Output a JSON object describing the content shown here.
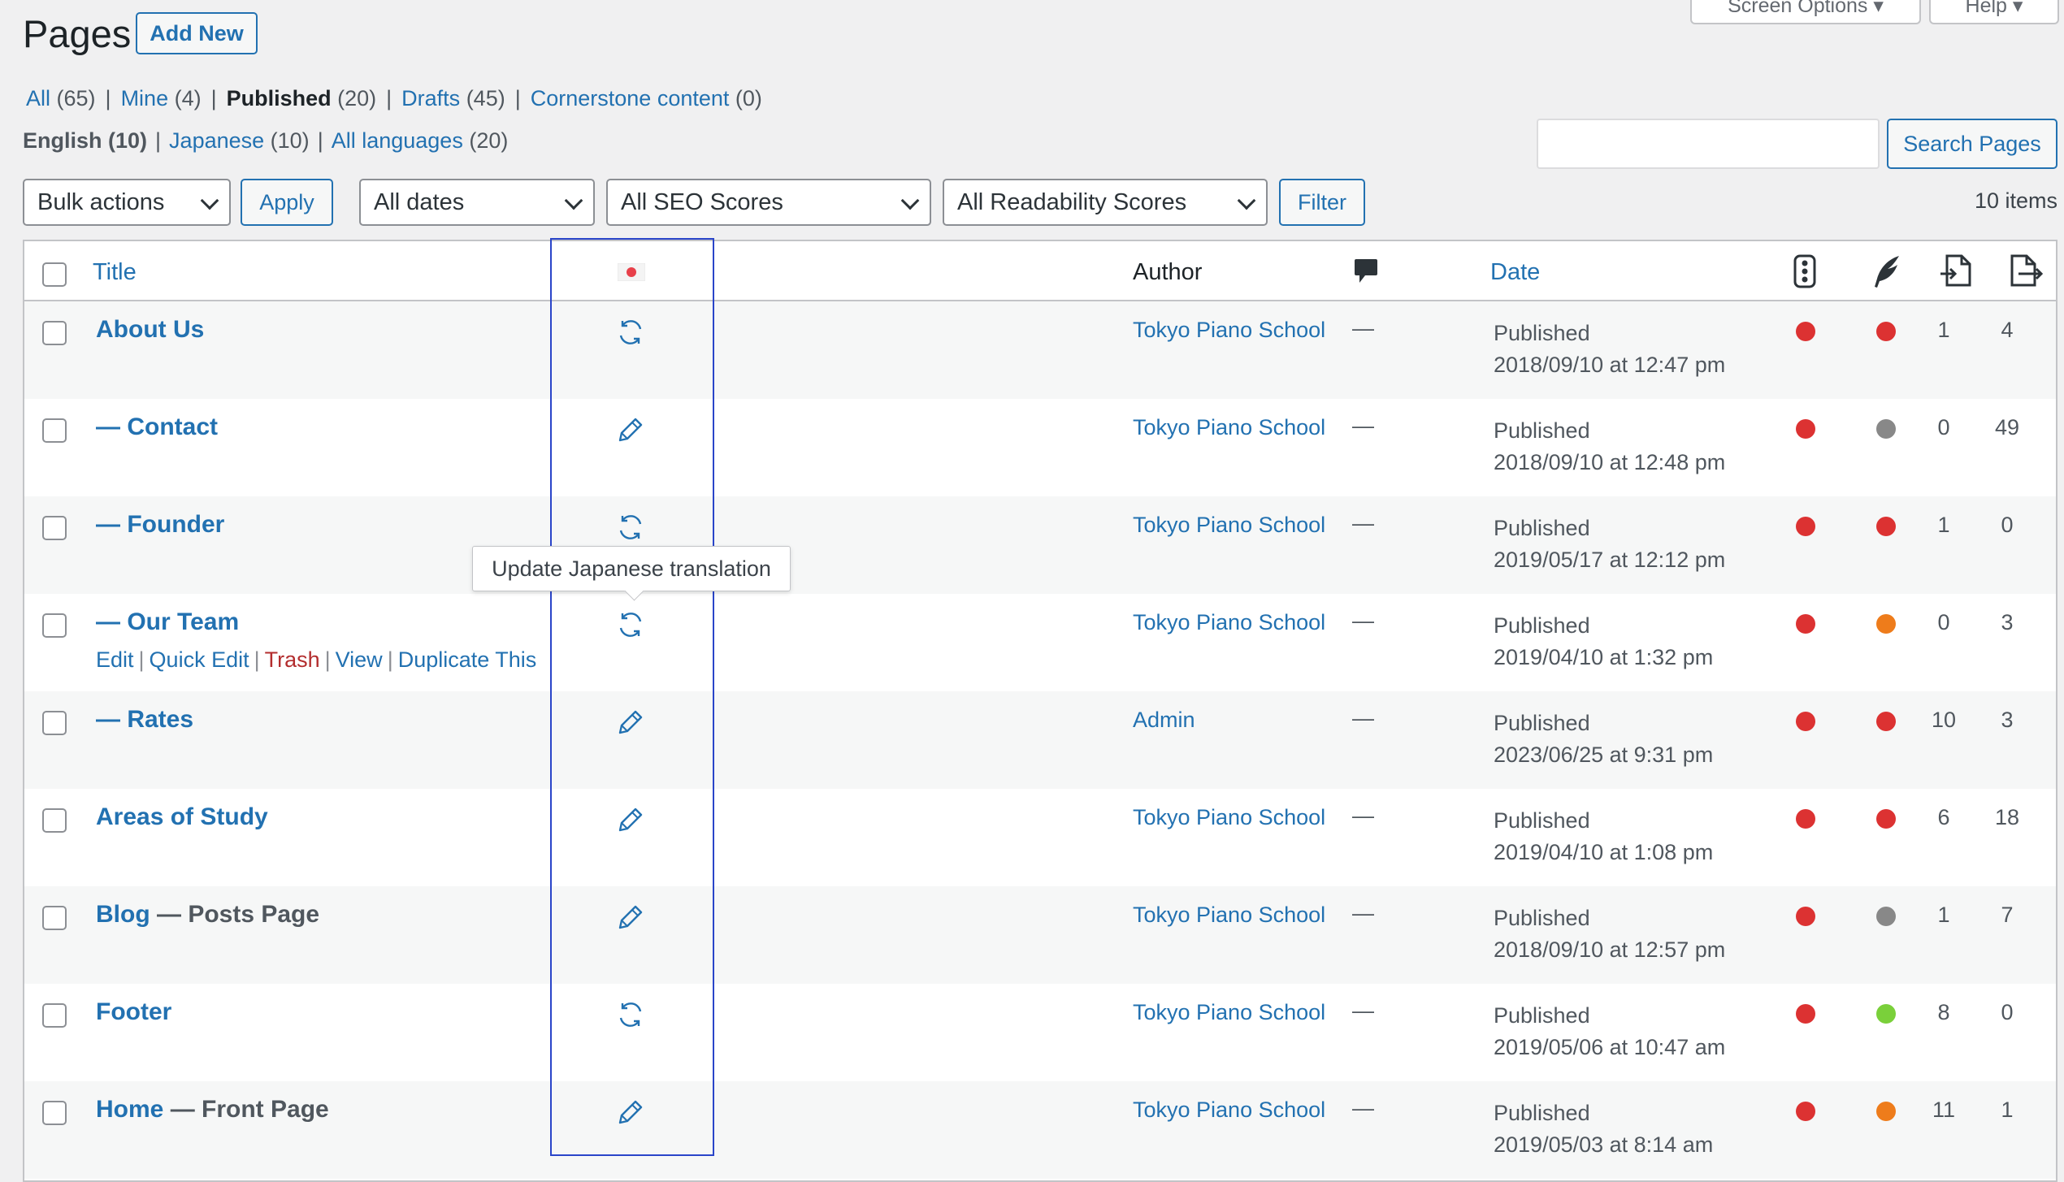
{
  "header": {
    "title": "Pages",
    "add_new_label": "Add New",
    "screen_options_label": "Screen Options ▾",
    "help_label": "Help ▾"
  },
  "views": [
    {
      "label": "All",
      "count": "(65)",
      "current": false
    },
    {
      "label": "Mine",
      "count": "(4)",
      "current": false
    },
    {
      "label": "Published",
      "count": "(20)",
      "current": true
    },
    {
      "label": "Drafts",
      "count": "(45)",
      "current": false
    },
    {
      "label": "Cornerstone content",
      "count": " (0)",
      "current": false
    }
  ],
  "languages": [
    {
      "label": "English",
      "count": "(10)",
      "current": true
    },
    {
      "label": "Japanese",
      "count": "(10)",
      "current": false
    },
    {
      "label": "All languages",
      "count": "(20)",
      "current": false
    }
  ],
  "search": {
    "placeholder": "",
    "button_label": "Search Pages"
  },
  "toolbar": {
    "bulk_actions": "Bulk actions",
    "apply_label": "Apply",
    "dates": "All dates",
    "seo_scores": "All SEO Scores",
    "readability_scores": "All Readability Scores",
    "filter_label": "Filter",
    "items_count": "10 items"
  },
  "columns": {
    "title": "Title",
    "author": "Author",
    "date": "Date"
  },
  "tooltip": "Update Japanese translation",
  "row_actions": {
    "edit": "Edit",
    "quick_edit": "Quick Edit",
    "trash": "Trash",
    "view": "View",
    "duplicate": "Duplicate This"
  },
  "status_colors": {
    "red": "#dc3232",
    "gray": "#888888",
    "orange": "#ee7c1b",
    "green": "#7ad03a"
  },
  "rows": [
    {
      "title": "About Us",
      "state": "",
      "icon": "sync-icon",
      "author": "Tokyo Piano School",
      "comments": "—",
      "status": "Published",
      "date": "2018/09/10 at 12:47 pm",
      "seo": "red",
      "read": "red",
      "links_out": "1",
      "links_in": "4"
    },
    {
      "title": "— Contact",
      "state": "",
      "icon": "pencil-icon",
      "author": "Tokyo Piano School",
      "comments": "—",
      "status": "Published",
      "date": "2018/09/10 at 12:48 pm",
      "seo": "red",
      "read": "gray",
      "links_out": "0",
      "links_in": "49"
    },
    {
      "title": "— Founder",
      "state": "",
      "icon": "sync-icon",
      "author": "Tokyo Piano School",
      "comments": "—",
      "status": "Published",
      "date": "2019/05/17 at 12:12 pm",
      "seo": "red",
      "read": "red",
      "links_out": "1",
      "links_in": "0"
    },
    {
      "title": "— Our Team",
      "state": "",
      "icon": "sync-icon",
      "author": "Tokyo Piano School",
      "comments": "—",
      "status": "Published",
      "date": "2019/04/10 at 1:32 pm",
      "seo": "red",
      "read": "orange",
      "links_out": "0",
      "links_in": "3",
      "show_actions": true
    },
    {
      "title": "— Rates",
      "state": "",
      "icon": "pencil-icon",
      "author": "Admin",
      "comments": "—",
      "status": "Published",
      "date": "2023/06/25 at 9:31 pm",
      "seo": "red",
      "read": "red",
      "links_out": "10",
      "links_in": "3"
    },
    {
      "title": "Areas of Study",
      "state": "",
      "icon": "pencil-icon",
      "author": "Tokyo Piano School",
      "comments": "—",
      "status": "Published",
      "date": "2019/04/10 at 1:08 pm",
      "seo": "red",
      "read": "red",
      "links_out": "6",
      "links_in": "18"
    },
    {
      "title": "Blog",
      "state": " — Posts Page",
      "icon": "pencil-icon",
      "author": "Tokyo Piano School",
      "comments": "—",
      "status": "Published",
      "date": "2018/09/10 at 12:57 pm",
      "seo": "red",
      "read": "gray",
      "links_out": "1",
      "links_in": "7"
    },
    {
      "title": "Footer",
      "state": "",
      "icon": "sync-icon",
      "author": "Tokyo Piano School",
      "comments": "—",
      "status": "Published",
      "date": "2019/05/06 at 10:47 am",
      "seo": "red",
      "read": "green",
      "links_out": "8",
      "links_in": "0"
    },
    {
      "title": "Home",
      "state": " — Front Page",
      "icon": "pencil-icon",
      "author": "Tokyo Piano School",
      "comments": "—",
      "status": "Published",
      "date": "2019/05/03 at 8:14 am",
      "seo": "red",
      "read": "orange",
      "links_out": "11",
      "links_in": "1"
    }
  ]
}
